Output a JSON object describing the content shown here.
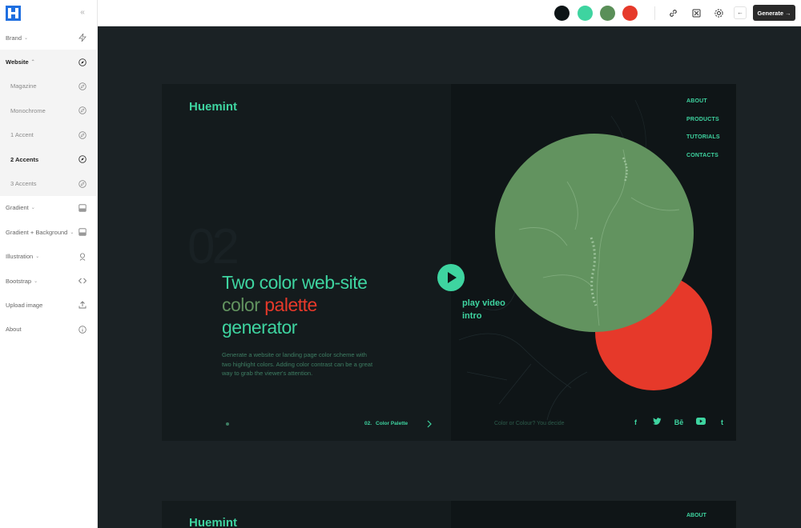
{
  "sidebar": {
    "items": [
      {
        "label": "Brand",
        "caret": "⌄",
        "icon": "bolt-icon"
      },
      {
        "label": "Website",
        "caret": "⌃",
        "icon": "compass-icon"
      },
      {
        "label": "Magazine",
        "icon": "compass-icon"
      },
      {
        "label": "Monochrome",
        "icon": "compass-icon"
      },
      {
        "label": "1 Accent",
        "icon": "compass-icon"
      },
      {
        "label": "2 Accents",
        "icon": "compass-icon"
      },
      {
        "label": "3 Accents",
        "icon": "compass-icon"
      },
      {
        "label": "Gradient",
        "caret": "⌄",
        "icon": "image-icon"
      },
      {
        "label": "Gradient + Background",
        "caret": "⌄",
        "icon": "image-icon"
      },
      {
        "label": "Illustration",
        "caret": "⌄",
        "icon": "brush-icon"
      },
      {
        "label": "Bootstrap",
        "caret": "⌄",
        "icon": "code-icon"
      },
      {
        "label": "Upload image",
        "icon": "upload-icon"
      },
      {
        "label": "About",
        "icon": "info-icon"
      }
    ]
  },
  "topbar": {
    "palette": [
      "#0d1416",
      "#3ed4a0",
      "#5a8f58",
      "#e6392a"
    ],
    "generate_label": "Generate",
    "back_label": "←"
  },
  "preview": {
    "brand": "Huemint",
    "ghost": "02",
    "headline_a": "Two color web-site ",
    "headline_b": "color",
    "headline_c": " palette",
    "headline_d": " generator",
    "description": "Generate a website or landing page color scheme with two highlight colors. Adding color contrast can be a great way to grab the viewer's attention.",
    "pager_num": "02.",
    "pager_label": "Color Palette",
    "nav": [
      "ABOUT",
      "PRODUCTS",
      "TUTORIALS",
      "CONTACTS"
    ],
    "play_label": "play video intro",
    "caption": "Color or Colour? You decide",
    "socials": [
      "f",
      "t",
      "Bē",
      "▶",
      "t"
    ]
  },
  "preview2": {
    "brand": "Huemint",
    "nav_first": "ABOUT"
  },
  "colors": {
    "accent": "#3ed4a0",
    "green": "#62935f",
    "red": "#e6392a",
    "bg": "#141b1d"
  }
}
